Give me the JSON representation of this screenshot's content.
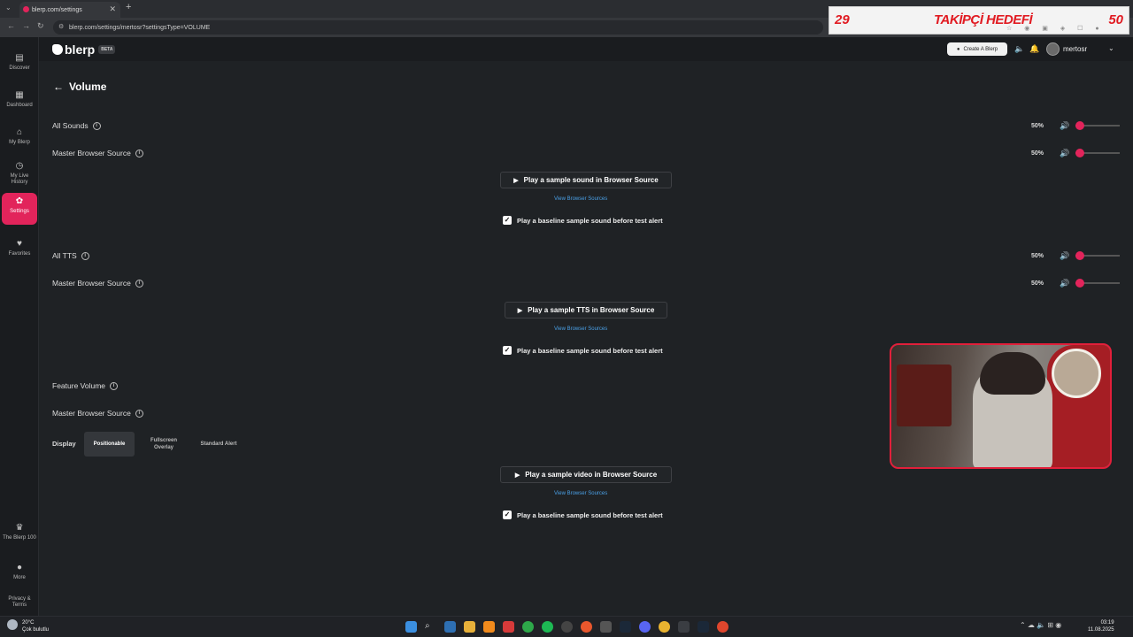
{
  "browser": {
    "tab_title": "blerp.com/settings",
    "url": "blerp.com/settings/mertosr?settingsType=VOLUME"
  },
  "stream_overlay": {
    "left_count": "29",
    "title": "TAKİPÇİ HEDEFİ",
    "right_count": "50"
  },
  "sidebar": {
    "items": [
      {
        "label": "Discover",
        "icon": "discover-icon"
      },
      {
        "label": "Dashboard",
        "icon": "dashboard-icon"
      },
      {
        "label": "My Blerp",
        "icon": "home-icon"
      },
      {
        "label": "My Live History",
        "icon": "history-icon"
      },
      {
        "label": "Settings",
        "icon": "gear-icon",
        "active": true
      },
      {
        "label": "Favorites",
        "icon": "heart-icon"
      }
    ],
    "bottom": [
      {
        "label": "The Blerp 100",
        "icon": "crown-icon"
      },
      {
        "label": "More",
        "icon": "more-icon"
      },
      {
        "label": "Privacy & Terms",
        "icon": ""
      }
    ]
  },
  "topbar": {
    "logo_text": "blerp",
    "beta": "BETA",
    "create_label": "Create A Blerp",
    "username": "mertosr"
  },
  "page": {
    "title": "Volume"
  },
  "sections": {
    "all_sounds": {
      "label": "All Sounds",
      "percent": "50%",
      "value": 50
    },
    "master_sounds": {
      "label": "Master Browser Source",
      "percent": "50%",
      "value": 50
    },
    "sound_button": "Play a sample sound in Browser Source",
    "view_sources_1": "View Browser Sources",
    "baseline_1": "Play a baseline sample sound before test alert",
    "all_tts": {
      "label": "All TTS",
      "percent": "50%",
      "value": 50
    },
    "master_tts": {
      "label": "Master Browser Source",
      "percent": "50%",
      "value": 50
    },
    "tts_button": "Play a sample TTS in Browser Source",
    "view_sources_2": "View Browser Sources",
    "baseline_2": "Play a baseline sample sound before test alert",
    "feature_volume": {
      "label": "Feature Volume"
    },
    "master_feature": {
      "label": "Master Browser Source"
    },
    "display": {
      "label": "Display",
      "options": [
        "Positionable",
        "Fullscreen Overlay",
        "Standard Alert"
      ],
      "selected": "Positionable"
    },
    "video_button": "Play a sample video in Browser Source",
    "view_sources_3": "View Browser Sources",
    "baseline_3": "Play a baseline sample sound before test alert"
  },
  "taskbar": {
    "temperature": "20°C",
    "weather": "Çok bulutlu",
    "time": "03:19",
    "date": "11.08.2025"
  },
  "colors": {
    "accent": "#e2245b",
    "background": "#1f2225",
    "link": "#4aa0e6"
  }
}
